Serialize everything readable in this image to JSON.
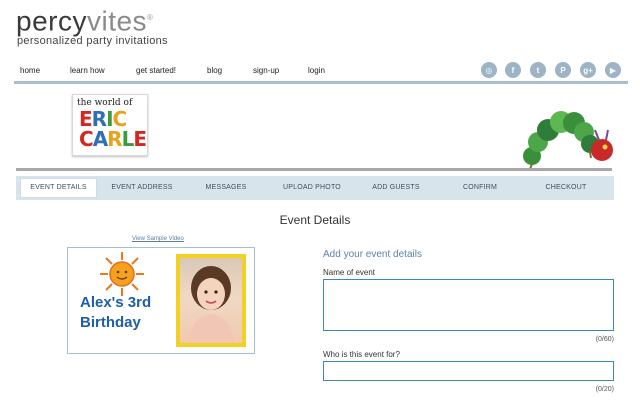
{
  "header": {
    "logo_part1": "percy",
    "logo_part2": "vites",
    "logo_mark": "®",
    "tagline": "personalized party invitations"
  },
  "topnav": {
    "items": [
      "home",
      "learn how",
      "get started!",
      "blog",
      "sign-up",
      "login"
    ]
  },
  "social": {
    "icons": [
      "instagram-icon",
      "facebook-icon",
      "twitter-icon",
      "pinterest-icon",
      "google-plus-icon",
      "youtube-icon"
    ],
    "glyphs": [
      "◎",
      "f",
      "t",
      "P",
      "g+",
      "▶"
    ],
    "color": "#9cb4c6"
  },
  "brand": {
    "line1": "the world of",
    "line2_letters": [
      "E",
      "R",
      "I",
      "C"
    ],
    "line3_letters": [
      "C",
      "A",
      "R",
      "L",
      "E"
    ],
    "letter_colors": [
      "#d6261f",
      "#2f6fb6",
      "#3a9b3f",
      "#e8a21b",
      "#d6261f",
      "#2f6fb6",
      "#e8a21b",
      "#3a9b3f",
      "#d6261f"
    ]
  },
  "steps": {
    "items": [
      "EVENT DETAILS",
      "EVENT ADDRESS",
      "MESSAGES",
      "UPLOAD PHOTO",
      "ADD GUESTS",
      "CONFIRM",
      "CHECKOUT"
    ],
    "active_index": 0
  },
  "main": {
    "section_title": "Event Details",
    "video_link": "View Sample Video"
  },
  "preview": {
    "title_line1": "Alex's 3rd",
    "title_line2": "Birthday",
    "frame_color": "#f2d024",
    "text_color": "#1e5ea8"
  },
  "form": {
    "heading": "Add your event details",
    "name_label": "Name of event",
    "name_value": "",
    "name_counter": "(0/60)",
    "for_label": "Who is this event for?",
    "for_value": "",
    "for_counter": "(0/20)"
  },
  "colors": {
    "accent": "#a8bfd0",
    "step_bar": "#d8e4ec",
    "field_border": "#3d86b8"
  }
}
